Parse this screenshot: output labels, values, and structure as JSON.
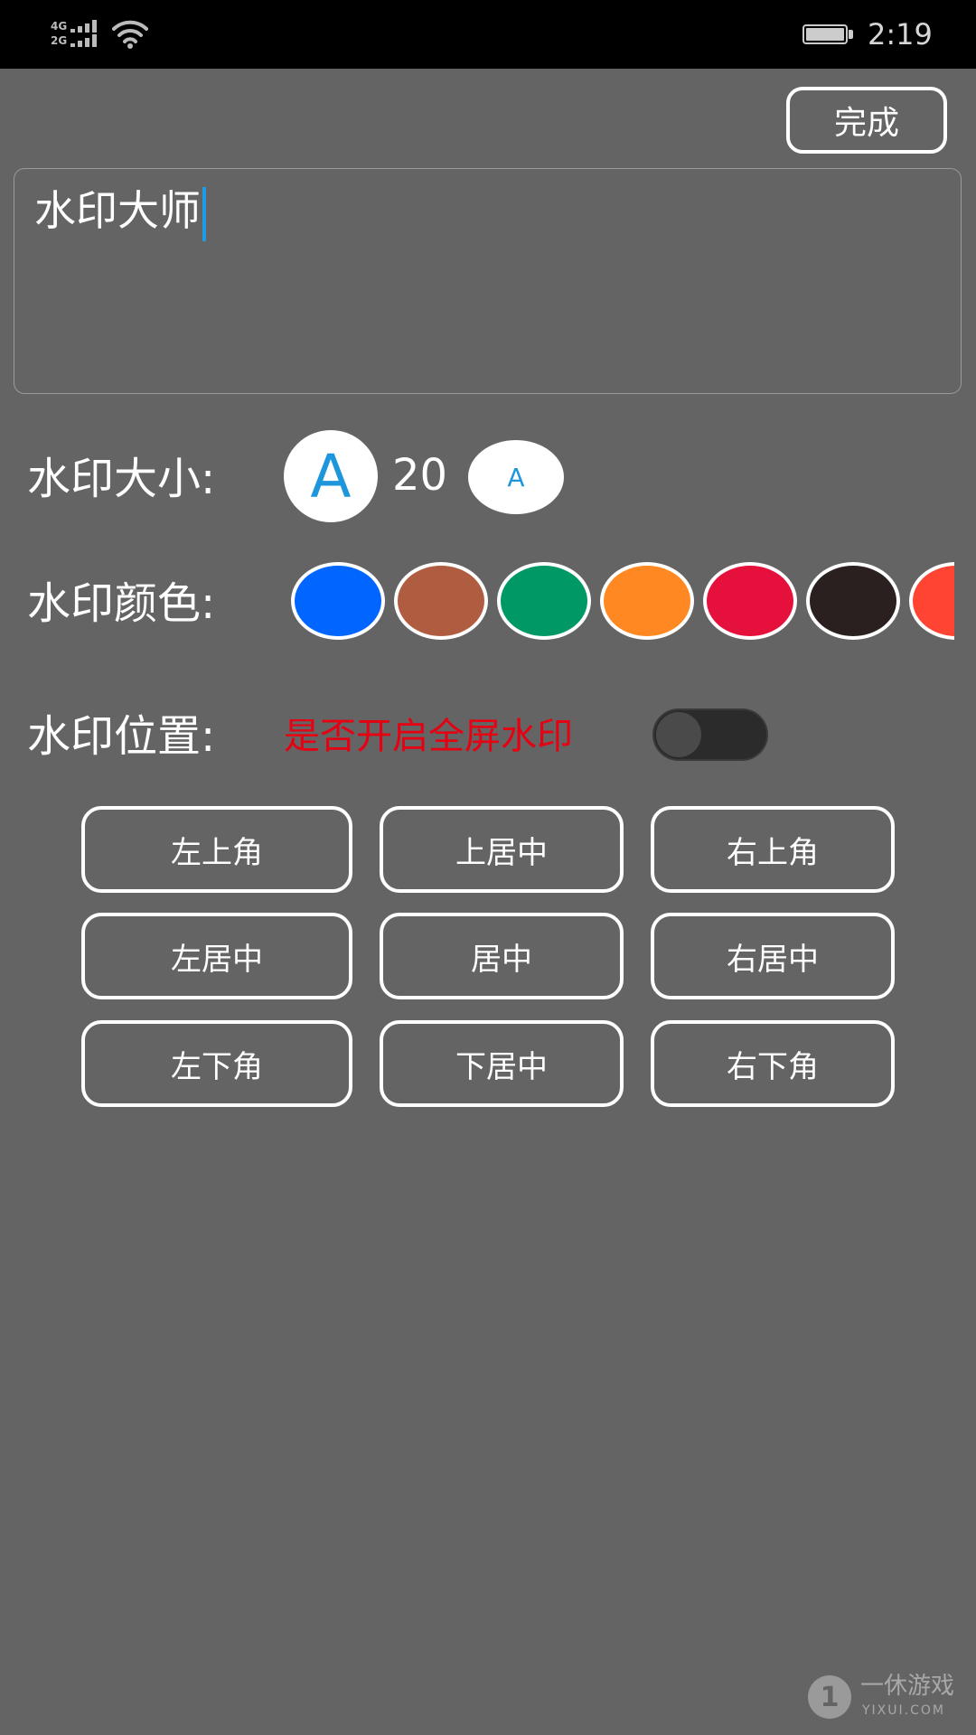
{
  "status_bar": {
    "network_top": "4G",
    "network_bottom": "2G",
    "time": "2:19"
  },
  "header": {
    "done_label": "完成"
  },
  "editor": {
    "text": "水印大师"
  },
  "size": {
    "label": "水印大小:",
    "increase_glyph": "A",
    "decrease_glyph": "A",
    "value": "20"
  },
  "color": {
    "label": "水印颜色:",
    "swatches": [
      "#0066ff",
      "#b05c40",
      "#009966",
      "#ff8822",
      "#e6103c",
      "#2a2020",
      "#ff4433"
    ]
  },
  "position": {
    "label": "水印位置:",
    "fullscreen_label": "是否开启全屏水印",
    "fullscreen_enabled": false,
    "buttons": {
      "top_left": "左上角",
      "top_center": "上居中",
      "top_right": "右上角",
      "middle_left": "左居中",
      "center": "居中",
      "middle_right": "右居中",
      "bottom_left": "左下角",
      "bottom_center": "下居中",
      "bottom_right": "右下角"
    }
  },
  "site_mark": {
    "logo_glyph": "1",
    "name": "一休游戏",
    "domain": "YIXUI.COM"
  }
}
